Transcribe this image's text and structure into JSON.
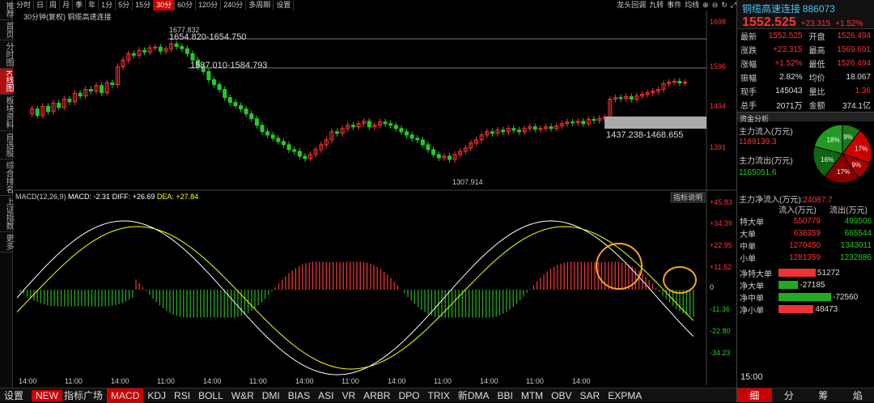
{
  "sidebar": [
    "推荐",
    "首页",
    "分时图",
    "K线图",
    "板块资料",
    "自选股",
    "综合排名",
    "上证指数",
    "更多"
  ],
  "sidebar_active": 3,
  "periods": [
    "分时",
    "日",
    "周",
    "月",
    "季",
    "年",
    "1分",
    "5分",
    "15分",
    "30分",
    "60分",
    "120分",
    "240分",
    "多周期",
    "设置"
  ],
  "period_active": 9,
  "toolbar_right": [
    "龙头回调",
    "九转",
    "事件",
    "均线"
  ],
  "chart_caption": "30分钟(复权) 铜缆高速连接",
  "price_axis": [
    "1698",
    "1596",
    "1494",
    "1391"
  ],
  "annotations": {
    "high": "1677.832",
    "range1": "1654.820-1654.750",
    "range2": "1587.010-1584.793",
    "range3": "1437.238-1468.655",
    "low": "1307.914"
  },
  "macd": {
    "label": "MACD(12,26,9)",
    "macd": "MACD: -2.31",
    "diff": "DIFF: +26.69",
    "dea": "DEA: +27.84",
    "button": "指标说明"
  },
  "macd_axis": [
    "+45.83",
    "+34.39",
    "+22.95",
    "+11.52",
    "0",
    "-11.36",
    "-22.80",
    "-34.23"
  ],
  "time_axis": [
    "14:00",
    "11:00",
    "14:00",
    "11:00",
    "14:00",
    "11:00",
    "14:00",
    "11:00",
    "14:00",
    "11:00",
    "14:00",
    "11:00",
    "14:00"
  ],
  "indicators": [
    "设置",
    "指标广场",
    "MACD",
    "KDJ",
    "RSI",
    "BOLL",
    "W&R",
    "DMI",
    "BIAS",
    "ASI",
    "VR",
    "ARBR",
    "DPO",
    "TRIX",
    "新DMA",
    "BBI",
    "MTM",
    "OBV",
    "SAR",
    "EXPMA"
  ],
  "indicator_new_label": "NEW",
  "stock": {
    "name": "铜缆高速连接",
    "code": "886073",
    "price": "1552.525",
    "change": "+23.315",
    "pct": "+1.52%"
  },
  "quote": [
    [
      "最新",
      "1552.525",
      "开盘",
      "1526.494"
    ],
    [
      "涨跌",
      "+23.315",
      "最高",
      "1569.691"
    ],
    [
      "涨幅",
      "+1.52%",
      "最低",
      "1526.494"
    ],
    [
      "振幅",
      "2.82%",
      "均价",
      "18.067"
    ],
    [
      "现手",
      "145043",
      "量比",
      "1.36"
    ],
    [
      "总手",
      "2071万",
      "金额",
      "374.1亿"
    ]
  ],
  "fund": {
    "title": "资金分析",
    "in_label": "主力流入(万元)",
    "in_val": "1189139.3",
    "out_label": "主力流出(万元)",
    "out_val": "1165051.6",
    "net_label": "主力净流入(万元):",
    "net_val": "24087.7",
    "pie": [
      "9%",
      "17%",
      "9%",
      "17%",
      "16%",
      "18%"
    ]
  },
  "flow_headers": [
    "流入(万元)",
    "流出(万元)"
  ],
  "flow": [
    [
      "特大单",
      "550779",
      "499506"
    ],
    [
      "大单",
      "638359",
      "665544"
    ],
    [
      "中单",
      "1270450",
      "1343011"
    ],
    [
      "小单",
      "1281359",
      "1232886"
    ]
  ],
  "net": [
    [
      "净特大单",
      "51272"
    ],
    [
      "净大单",
      "-27185"
    ],
    [
      "净中单",
      "-72560"
    ],
    [
      "净小单",
      "48473"
    ]
  ],
  "time": "15:00",
  "footer": [
    "细",
    "分",
    "筹",
    "焰"
  ],
  "colors": {
    "up": "#f33",
    "down": "#2c2",
    "accent": "#c00"
  }
}
